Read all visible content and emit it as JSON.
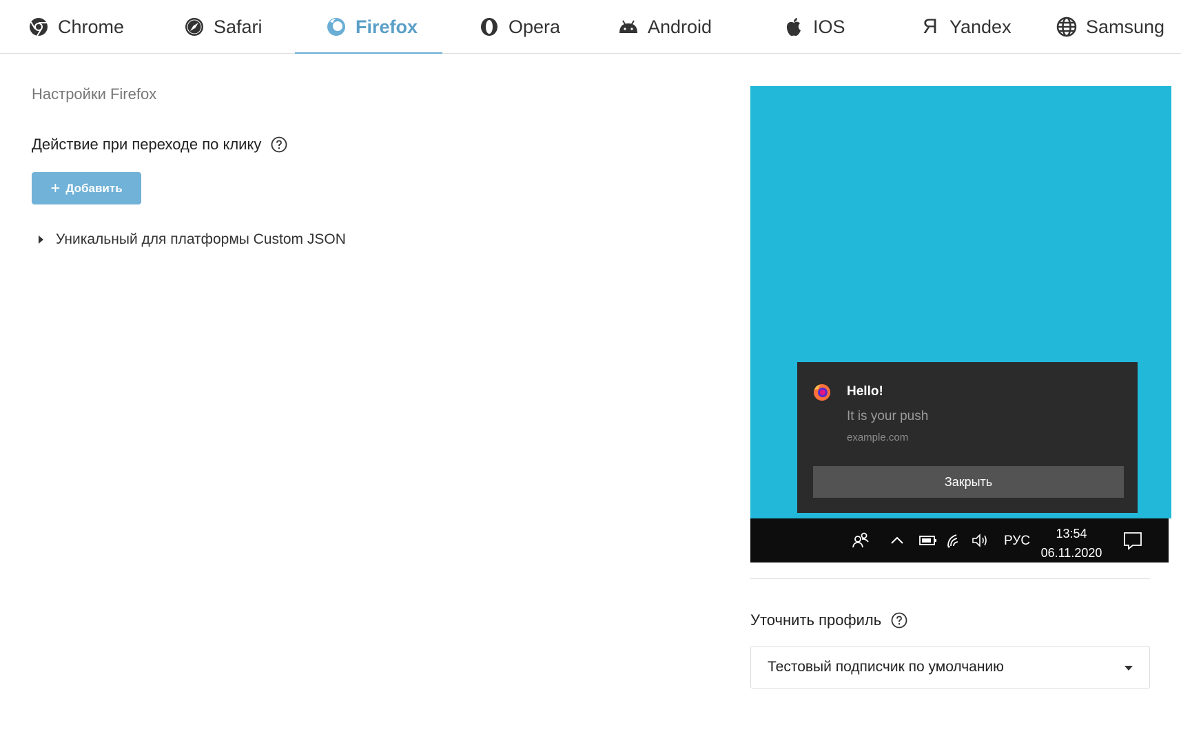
{
  "tabs": [
    {
      "label": "Chrome",
      "icon": "chrome-icon"
    },
    {
      "label": "Safari",
      "icon": "safari-icon"
    },
    {
      "label": "Firefox",
      "icon": "firefox-icon"
    },
    {
      "label": "Opera",
      "icon": "opera-icon"
    },
    {
      "label": "Android",
      "icon": "android-icon"
    },
    {
      "label": "IOS",
      "icon": "apple-icon"
    },
    {
      "label": "Yandex",
      "icon": "yandex-icon"
    },
    {
      "label": "Samsung",
      "icon": "globe-icon"
    }
  ],
  "active_tab": "Firefox",
  "settings": {
    "title": "Настройки Firefox",
    "click_action_label": "Действие при переходе по клику",
    "add_button": "Добавить",
    "custom_json_label": "Уникальный для платформы Custom JSON"
  },
  "preview": {
    "background_color": "#22b8d9",
    "notification": {
      "title": "Hello!",
      "body": "It is your push",
      "site": "example.com",
      "close_button": "Закрыть"
    },
    "taskbar": {
      "language": "РУС",
      "time": "13:54",
      "date": "06.11.2020"
    }
  },
  "profile": {
    "label": "Уточнить профиль",
    "selected": "Тестовый подписчик по умолчанию"
  },
  "colors": {
    "accent": "#6aaed6",
    "active_tab_text": "#5a9fc7"
  }
}
